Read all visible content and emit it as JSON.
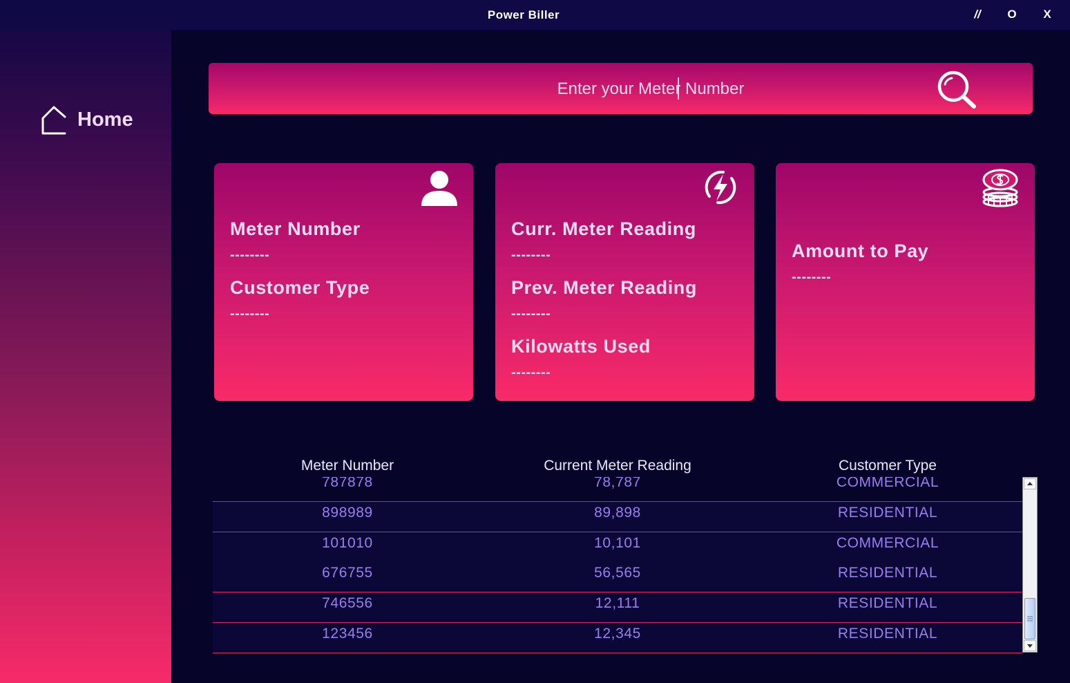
{
  "window": {
    "title": "Power Biller",
    "minimize_label": "//",
    "maximize_label": "O",
    "close_label": "X"
  },
  "sidebar": {
    "items": [
      {
        "label": "Home",
        "icon": "home-icon"
      }
    ]
  },
  "search": {
    "placeholder": "Enter your Meter Number",
    "value": "",
    "icon": "search-icon"
  },
  "cards": {
    "meter": {
      "icon": "user-icon",
      "meter_number_label": "Meter Number",
      "meter_number_value": "--------",
      "customer_type_label": "Customer Type",
      "customer_type_value": "--------"
    },
    "reading": {
      "icon": "lightning-icon",
      "current_label": "Curr. Meter Reading",
      "current_value": "--------",
      "previous_label": "Prev. Meter Reading",
      "previous_value": "--------",
      "kilowatts_label": "Kilowatts Used",
      "kilowatts_value": "--------"
    },
    "amount": {
      "icon": "coins-icon",
      "amount_label": "Amount to Pay",
      "amount_value": "--------"
    }
  },
  "table": {
    "columns": [
      "Meter Number",
      "Current Meter Reading",
      "Customer Type"
    ],
    "rows": [
      [
        "787878",
        "78,787",
        "COMMERCIAL"
      ],
      [
        "898989",
        "89,898",
        "RESIDENTIAL"
      ],
      [
        "101010",
        "10,101",
        "COMMERCIAL"
      ],
      [
        "676755",
        "56,565",
        "RESIDENTIAL"
      ],
      [
        "746556",
        "12,111",
        "RESIDENTIAL"
      ],
      [
        "123456",
        "12,345",
        "RESIDENTIAL"
      ]
    ]
  },
  "colors": {
    "accent_pink": "#f72a68",
    "accent_magenta": "#a5086a",
    "background": "#07042a",
    "table_text": "#9a7ef0",
    "row_divider": "#d8245c"
  }
}
